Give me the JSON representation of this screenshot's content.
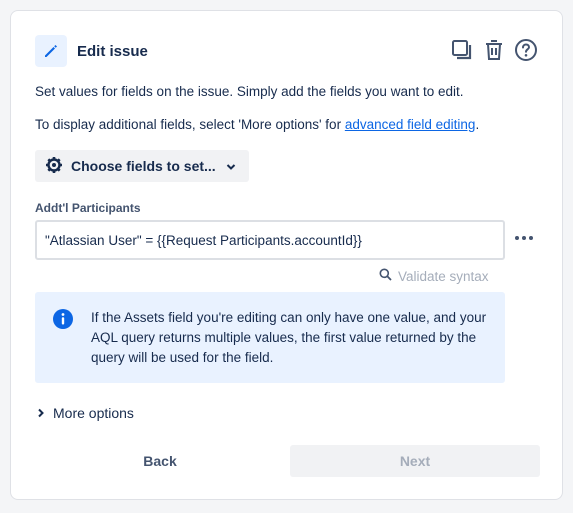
{
  "header": {
    "title": "Edit issue",
    "icons": [
      "pencil-icon",
      "duplicate-icon",
      "trash-icon",
      "help-icon"
    ]
  },
  "description": {
    "line1": "Set values for fields on the issue. Simply add the fields you want to edit.",
    "line2_prefix": "To display additional fields, select 'More options' for ",
    "line2_link": "advanced field editing",
    "line2_suffix": "."
  },
  "choose_fields": {
    "label": "Choose fields to set...",
    "icon": "gear-icon"
  },
  "field": {
    "label": "Addt'l Participants",
    "value": "\"Atlassian User\" = {{Request Participants.accountId}}"
  },
  "validate": {
    "label": "Validate syntax",
    "icon": "search-icon"
  },
  "info": {
    "text": "If the Assets field you're editing can only have one value, and your AQL query returns multiple values, the first value returned by the query will be used for the field."
  },
  "more_options": {
    "label": "More options"
  },
  "footer": {
    "back_label": "Back",
    "next_label": "Next"
  },
  "colors": {
    "accent": "#0c66e4",
    "info_bg": "#e9f2ff",
    "button_bg": "#f1f2f4",
    "disabled_text": "#a5adba"
  }
}
